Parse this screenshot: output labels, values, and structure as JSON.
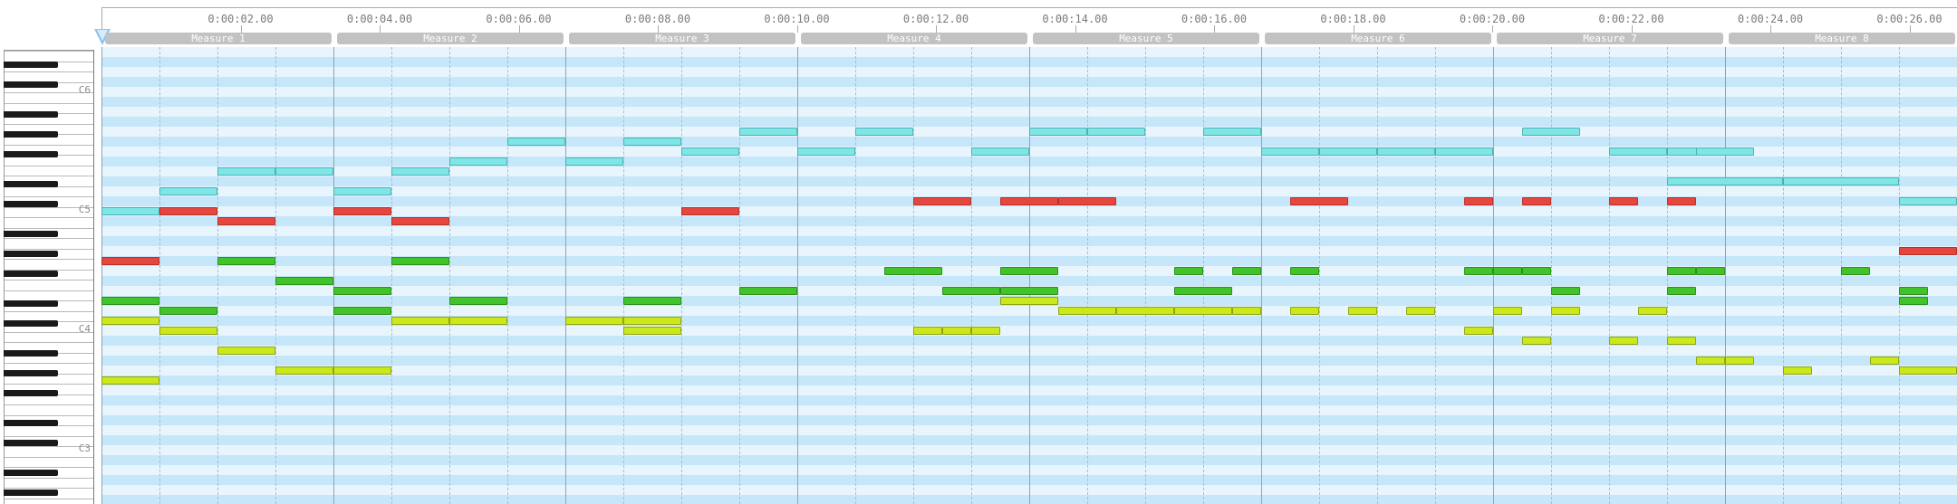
{
  "timeline": {
    "time_labels": [
      "0:00:02.00",
      "0:00:04.00",
      "0:00:06.00",
      "0:00:08.00",
      "0:00:10.00",
      "0:00:12.00",
      "0:00:14.00",
      "0:00:16.00",
      "0:00:18.00",
      "0:00:20.00",
      "0:00:22.00",
      "0:00:24.00",
      "0:00:26.00"
    ],
    "measures": [
      "Measure 1",
      "Measure 2",
      "Measure 3",
      "Measure 4",
      "Measure 5",
      "Measure 6",
      "Measure 7",
      "Measure 8"
    ]
  },
  "keyboard": {
    "octave_labels": [
      "C6",
      "C5",
      "C4",
      "C3"
    ]
  },
  "colors": {
    "cyan": "#7fe6e6",
    "red": "#e5473f",
    "green": "#41c42a",
    "yellow": "#cbe81b",
    "lane_dark": "#c6e6fa",
    "lane_light": "#e8f5fd"
  },
  "notes": {
    "cyan": [
      {
        "beat": 0,
        "dur": 1,
        "pitch": 72
      },
      {
        "beat": 1,
        "dur": 1,
        "pitch": 74
      },
      {
        "beat": 2,
        "dur": 1,
        "pitch": 76
      },
      {
        "beat": 3,
        "dur": 1,
        "pitch": 76
      },
      {
        "beat": 4,
        "dur": 1,
        "pitch": 74
      },
      {
        "beat": 5,
        "dur": 1,
        "pitch": 76
      },
      {
        "beat": 6,
        "dur": 1,
        "pitch": 77
      },
      {
        "beat": 7,
        "dur": 1,
        "pitch": 79
      },
      {
        "beat": 8,
        "dur": 1,
        "pitch": 77
      },
      {
        "beat": 9,
        "dur": 1,
        "pitch": 79
      },
      {
        "beat": 10,
        "dur": 1,
        "pitch": 78
      },
      {
        "beat": 11,
        "dur": 1,
        "pitch": 80
      },
      {
        "beat": 12,
        "dur": 1,
        "pitch": 78
      },
      {
        "beat": 13,
        "dur": 1,
        "pitch": 80
      },
      {
        "beat": 15,
        "dur": 1,
        "pitch": 78
      },
      {
        "beat": 16,
        "dur": 1,
        "pitch": 80
      },
      {
        "beat": 17,
        "dur": 1,
        "pitch": 80
      },
      {
        "beat": 19,
        "dur": 1,
        "pitch": 80
      },
      {
        "beat": 20,
        "dur": 1,
        "pitch": 78
      },
      {
        "beat": 21,
        "dur": 1,
        "pitch": 78
      },
      {
        "beat": 22,
        "dur": 1,
        "pitch": 78
      },
      {
        "beat": 23,
        "dur": 1,
        "pitch": 78
      },
      {
        "beat": 24.5,
        "dur": 1,
        "pitch": 80
      },
      {
        "beat": 26,
        "dur": 1,
        "pitch": 78
      },
      {
        "beat": 27,
        "dur": 1,
        "pitch": 78
      },
      {
        "beat": 27.5,
        "dur": 1,
        "pitch": 78
      },
      {
        "beat": 27,
        "dur": 2,
        "pitch": 75
      },
      {
        "beat": 29,
        "dur": 2,
        "pitch": 75
      },
      {
        "beat": 31,
        "dur": 1,
        "pitch": 73
      }
    ],
    "red": [
      {
        "beat": 0,
        "dur": 1,
        "pitch": 67
      },
      {
        "beat": 1,
        "dur": 1,
        "pitch": 72
      },
      {
        "beat": 2,
        "dur": 1,
        "pitch": 71
      },
      {
        "beat": 4,
        "dur": 1,
        "pitch": 72
      },
      {
        "beat": 5,
        "dur": 1,
        "pitch": 71
      },
      {
        "beat": 10,
        "dur": 1,
        "pitch": 72
      },
      {
        "beat": 14,
        "dur": 1,
        "pitch": 73
      },
      {
        "beat": 15.5,
        "dur": 1,
        "pitch": 73
      },
      {
        "beat": 16.5,
        "dur": 1,
        "pitch": 73
      },
      {
        "beat": 20.5,
        "dur": 1,
        "pitch": 73
      },
      {
        "beat": 23.5,
        "dur": 0.5,
        "pitch": 73
      },
      {
        "beat": 24.5,
        "dur": 0.5,
        "pitch": 73
      },
      {
        "beat": 26,
        "dur": 0.5,
        "pitch": 73
      },
      {
        "beat": 27,
        "dur": 0.5,
        "pitch": 73
      },
      {
        "beat": 31,
        "dur": 1,
        "pitch": 68
      }
    ],
    "green": [
      {
        "beat": 0,
        "dur": 1,
        "pitch": 63
      },
      {
        "beat": 1,
        "dur": 1,
        "pitch": 62
      },
      {
        "beat": 2,
        "dur": 1,
        "pitch": 67
      },
      {
        "beat": 3,
        "dur": 1,
        "pitch": 65
      },
      {
        "beat": 4,
        "dur": 1,
        "pitch": 64
      },
      {
        "beat": 4,
        "dur": 1,
        "pitch": 62
      },
      {
        "beat": 5,
        "dur": 1,
        "pitch": 67
      },
      {
        "beat": 6,
        "dur": 1,
        "pitch": 63
      },
      {
        "beat": 9,
        "dur": 1,
        "pitch": 63
      },
      {
        "beat": 11,
        "dur": 1,
        "pitch": 64
      },
      {
        "beat": 13.5,
        "dur": 1,
        "pitch": 66
      },
      {
        "beat": 14.5,
        "dur": 1,
        "pitch": 64
      },
      {
        "beat": 15.5,
        "dur": 1,
        "pitch": 64
      },
      {
        "beat": 15.5,
        "dur": 1,
        "pitch": 66
      },
      {
        "beat": 18.5,
        "dur": 0.5,
        "pitch": 66
      },
      {
        "beat": 18.5,
        "dur": 1,
        "pitch": 64
      },
      {
        "beat": 19.5,
        "dur": 0.5,
        "pitch": 66
      },
      {
        "beat": 20.5,
        "dur": 0.5,
        "pitch": 66
      },
      {
        "beat": 23.5,
        "dur": 0.5,
        "pitch": 66
      },
      {
        "beat": 24,
        "dur": 0.5,
        "pitch": 66
      },
      {
        "beat": 24.5,
        "dur": 0.5,
        "pitch": 66
      },
      {
        "beat": 25,
        "dur": 0.5,
        "pitch": 64
      },
      {
        "beat": 27,
        "dur": 0.5,
        "pitch": 66
      },
      {
        "beat": 27.5,
        "dur": 0.5,
        "pitch": 66
      },
      {
        "beat": 27,
        "dur": 0.5,
        "pitch": 64
      },
      {
        "beat": 30,
        "dur": 0.5,
        "pitch": 66
      },
      {
        "beat": 31,
        "dur": 0.5,
        "pitch": 64
      },
      {
        "beat": 31,
        "dur": 0.5,
        "pitch": 63
      }
    ],
    "yellow": [
      {
        "beat": 0,
        "dur": 1,
        "pitch": 61
      },
      {
        "beat": 1,
        "dur": 1,
        "pitch": 60
      },
      {
        "beat": 2,
        "dur": 1,
        "pitch": 58
      },
      {
        "beat": 3,
        "dur": 1,
        "pitch": 56
      },
      {
        "beat": 4,
        "dur": 1,
        "pitch": 56
      },
      {
        "beat": 5,
        "dur": 1,
        "pitch": 61
      },
      {
        "beat": 6,
        "dur": 1,
        "pitch": 61
      },
      {
        "beat": 8,
        "dur": 1,
        "pitch": 61
      },
      {
        "beat": 9,
        "dur": 1,
        "pitch": 61
      },
      {
        "beat": 9,
        "dur": 1,
        "pitch": 60
      },
      {
        "beat": 0,
        "dur": 1,
        "pitch": 55
      },
      {
        "beat": 14,
        "dur": 0.5,
        "pitch": 60
      },
      {
        "beat": 14.5,
        "dur": 0.5,
        "pitch": 60
      },
      {
        "beat": 15,
        "dur": 0.5,
        "pitch": 60
      },
      {
        "beat": 15.5,
        "dur": 1,
        "pitch": 63
      },
      {
        "beat": 16.5,
        "dur": 1,
        "pitch": 62
      },
      {
        "beat": 17.5,
        "dur": 1,
        "pitch": 62
      },
      {
        "beat": 18.5,
        "dur": 1,
        "pitch": 62
      },
      {
        "beat": 19.5,
        "dur": 0.5,
        "pitch": 62
      },
      {
        "beat": 20.5,
        "dur": 0.5,
        "pitch": 62
      },
      {
        "beat": 21.5,
        "dur": 0.5,
        "pitch": 62
      },
      {
        "beat": 22.5,
        "dur": 0.5,
        "pitch": 62
      },
      {
        "beat": 23.5,
        "dur": 0.5,
        "pitch": 60
      },
      {
        "beat": 24,
        "dur": 0.5,
        "pitch": 62
      },
      {
        "beat": 25,
        "dur": 0.5,
        "pitch": 62
      },
      {
        "beat": 24.5,
        "dur": 0.5,
        "pitch": 59
      },
      {
        "beat": 26,
        "dur": 0.5,
        "pitch": 59
      },
      {
        "beat": 26.5,
        "dur": 0.5,
        "pitch": 62
      },
      {
        "beat": 27,
        "dur": 0.5,
        "pitch": 59
      },
      {
        "beat": 27.5,
        "dur": 0.5,
        "pitch": 57
      },
      {
        "beat": 28,
        "dur": 0.5,
        "pitch": 57
      },
      {
        "beat": 29,
        "dur": 0.5,
        "pitch": 56
      },
      {
        "beat": 30.5,
        "dur": 0.5,
        "pitch": 57
      },
      {
        "beat": 31,
        "dur": 1,
        "pitch": 56
      }
    ]
  }
}
